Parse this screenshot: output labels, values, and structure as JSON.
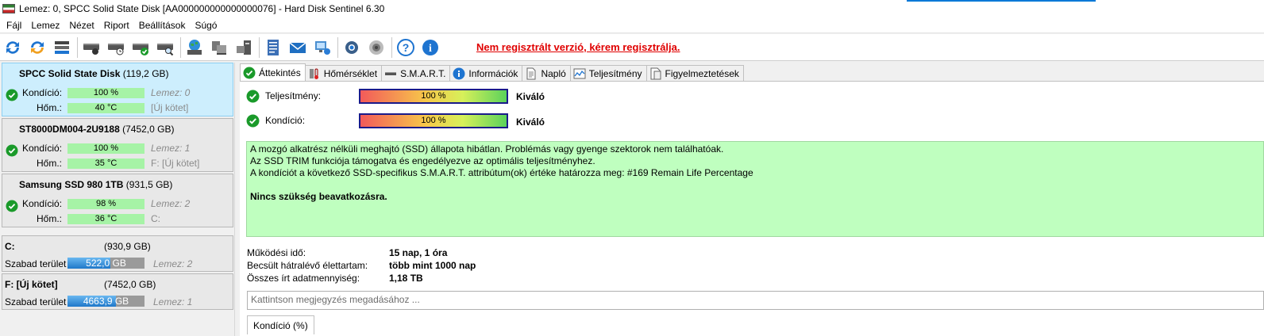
{
  "window": {
    "title": "Lemez: 0, SPCC Solid State Disk [AA000000000000000076]  -  Hard Disk Sentinel 6.30"
  },
  "menu": [
    "Fájl",
    "Lemez",
    "Nézet",
    "Riport",
    "Beállítások",
    "Súgó"
  ],
  "toolbar": {
    "icons": [
      "refresh-icon",
      "refresh-all-icon",
      "disk-list-icon",
      "disk-test-icon",
      "disk-schedule-icon",
      "disk-ok-icon",
      "disk-search-icon",
      "globe-disk-icon",
      "network-disk-icon",
      "server-disk-icon",
      "report-icon",
      "email-icon",
      "send-report-icon",
      "settings-icon",
      "sound-icon",
      "help-icon",
      "info-icon"
    ],
    "register_notice": "Nem regisztrált verzió, kérem regisztrálja."
  },
  "disks": [
    {
      "name": "SPCC Solid State Disk",
      "size": "(119,2 GB)",
      "condition_label": "Kondíció:",
      "condition": "100 %",
      "condition_value": 100,
      "disk_label": "Lemez: 0",
      "temp_label": "Hőm.:",
      "temp": "40 °C",
      "volume": "[Új kötet]",
      "selected": true
    },
    {
      "name": "ST8000DM004-2U9188",
      "size": "(7452,0 GB)",
      "condition_label": "Kondíció:",
      "condition": "100 %",
      "condition_value": 100,
      "disk_label": "Lemez: 1",
      "temp_label": "Hőm.:",
      "temp": "35 °C",
      "volume": "F: [Új kötet]",
      "selected": false
    },
    {
      "name": "Samsung SSD 980 1TB",
      "size": "(931,5 GB)",
      "condition_label": "Kondíció:",
      "condition": "98 %",
      "condition_value": 98,
      "disk_label": "Lemez: 2",
      "temp_label": "Hőm.:",
      "temp": "36 °C",
      "volume": "C:",
      "selected": false
    }
  ],
  "volumes": [
    {
      "name": "C:",
      "size": "(930,9 GB)",
      "free_label": "Szabad terület",
      "free": "522,0 GB",
      "free_fraction": 0.561,
      "disk_label": "Lemez: 2"
    },
    {
      "name": "F: [Új kötet]",
      "size": "(7452,0 GB)",
      "free_label": "Szabad terület",
      "free": "4663,9 GB",
      "free_fraction": 0.626,
      "disk_label": "Lemez: 1"
    }
  ],
  "tabs": [
    {
      "label": "Áttekintés",
      "icon": "check-icon",
      "active": true
    },
    {
      "label": "Hőmérséklet",
      "icon": "thermometer-icon",
      "active": false
    },
    {
      "label": "S.M.A.R.T.",
      "icon": "smart-icon",
      "active": false
    },
    {
      "label": "Információk",
      "icon": "info-icon",
      "active": false
    },
    {
      "label": "Napló",
      "icon": "log-icon",
      "active": false
    },
    {
      "label": "Teljesítmény",
      "icon": "chart-icon",
      "active": false
    },
    {
      "label": "Figyelmeztetések",
      "icon": "alerts-icon",
      "active": false
    }
  ],
  "overview": {
    "performance_label": "Teljesítmény:",
    "performance": "100 %",
    "performance_rating": "Kiváló",
    "condition_label": "Kondíció:",
    "condition": "100 %",
    "condition_rating": "Kiváló",
    "info_lines": [
      "A mozgó alkatrész nélküli meghajtó (SSD) állapota hibátlan. Problémás vagy gyenge szektorok nem találhatóak.",
      "Az SSD TRIM funkciója támogatva és engedélyezve az optimális teljesítményhez.",
      "A kondíciót a következő SSD-specifikus S.M.A.R.T. attribútum(ok) értéke határozza meg:  #169 Remain Life Percentage"
    ],
    "advice": "Nincs szükség beavatkozásra.",
    "stats": [
      {
        "label": "Működési idő:",
        "value": "15 nap, 1 óra"
      },
      {
        "label": "Becsült hátralévő élettartam:",
        "value": "több mint 1000 nap"
      },
      {
        "label": "Összes írt adatmennyiség:",
        "value": "1,18 TB"
      }
    ],
    "note_placeholder": "Kattintson megjegyzés megadásához ...",
    "condition_tab": "Kondíció  (%)"
  }
}
